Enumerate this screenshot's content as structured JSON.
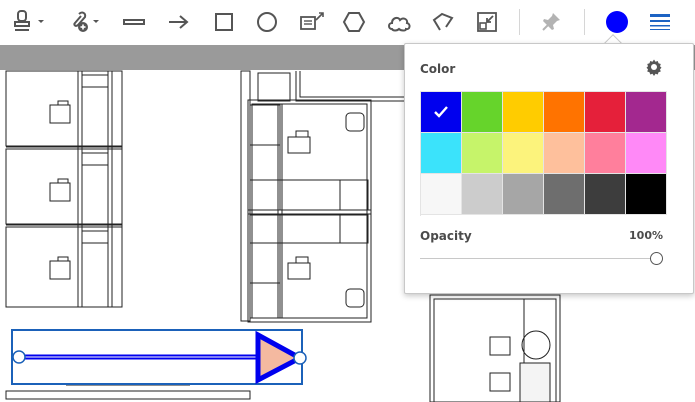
{
  "toolbar": {
    "tools": [
      {
        "name": "stamp-tool",
        "icon": "stamp-icon"
      },
      {
        "name": "attach-file-tool",
        "icon": "paperclip-plus-icon"
      },
      {
        "name": "line-tool",
        "icon": "line-icon"
      },
      {
        "name": "arrow-tool",
        "icon": "arrow-icon"
      },
      {
        "name": "rectangle-tool",
        "icon": "rectangle-icon"
      },
      {
        "name": "oval-tool",
        "icon": "oval-icon"
      },
      {
        "name": "text-callout-tool",
        "icon": "text-callout-icon"
      },
      {
        "name": "polygon-tool",
        "icon": "hexagon-icon"
      },
      {
        "name": "cloud-tool",
        "icon": "cloud-icon"
      },
      {
        "name": "polygon-line-tool",
        "icon": "polygon-line-icon"
      },
      {
        "name": "shrink-tool",
        "icon": "shrink-icon"
      },
      {
        "name": "pin-tool",
        "icon": "pin-icon"
      },
      {
        "name": "color-picker-tool",
        "icon": "color-circle-icon"
      },
      {
        "name": "line-weight-tool",
        "icon": "line-weight-icon"
      }
    ],
    "active_color": "#0000ff"
  },
  "color_popup": {
    "title": "Color",
    "settings_icon": "gear-icon",
    "swatches": [
      [
        "#0000ee",
        "#66d42b",
        "#ffcc00",
        "#ff7300",
        "#e5203a",
        "#a3288f"
      ],
      [
        "#3be3fb",
        "#c6f46a",
        "#fcf37c",
        "#fec09c",
        "#ff7f9c",
        "#ff89f7"
      ],
      [
        "#f7f7f7",
        "#cccccc",
        "#a6a6a6",
        "#6e6e6e",
        "#3d3d3d",
        "#000000"
      ]
    ],
    "selected_index": 0,
    "opacity_label": "Opacity",
    "opacity_value": "100%",
    "opacity_level": 1.0
  },
  "annotation": {
    "type": "arrow",
    "stroke_color": "#0000ee",
    "fill_color": "#f4b9a0",
    "selection_color": "#1b61b9"
  }
}
